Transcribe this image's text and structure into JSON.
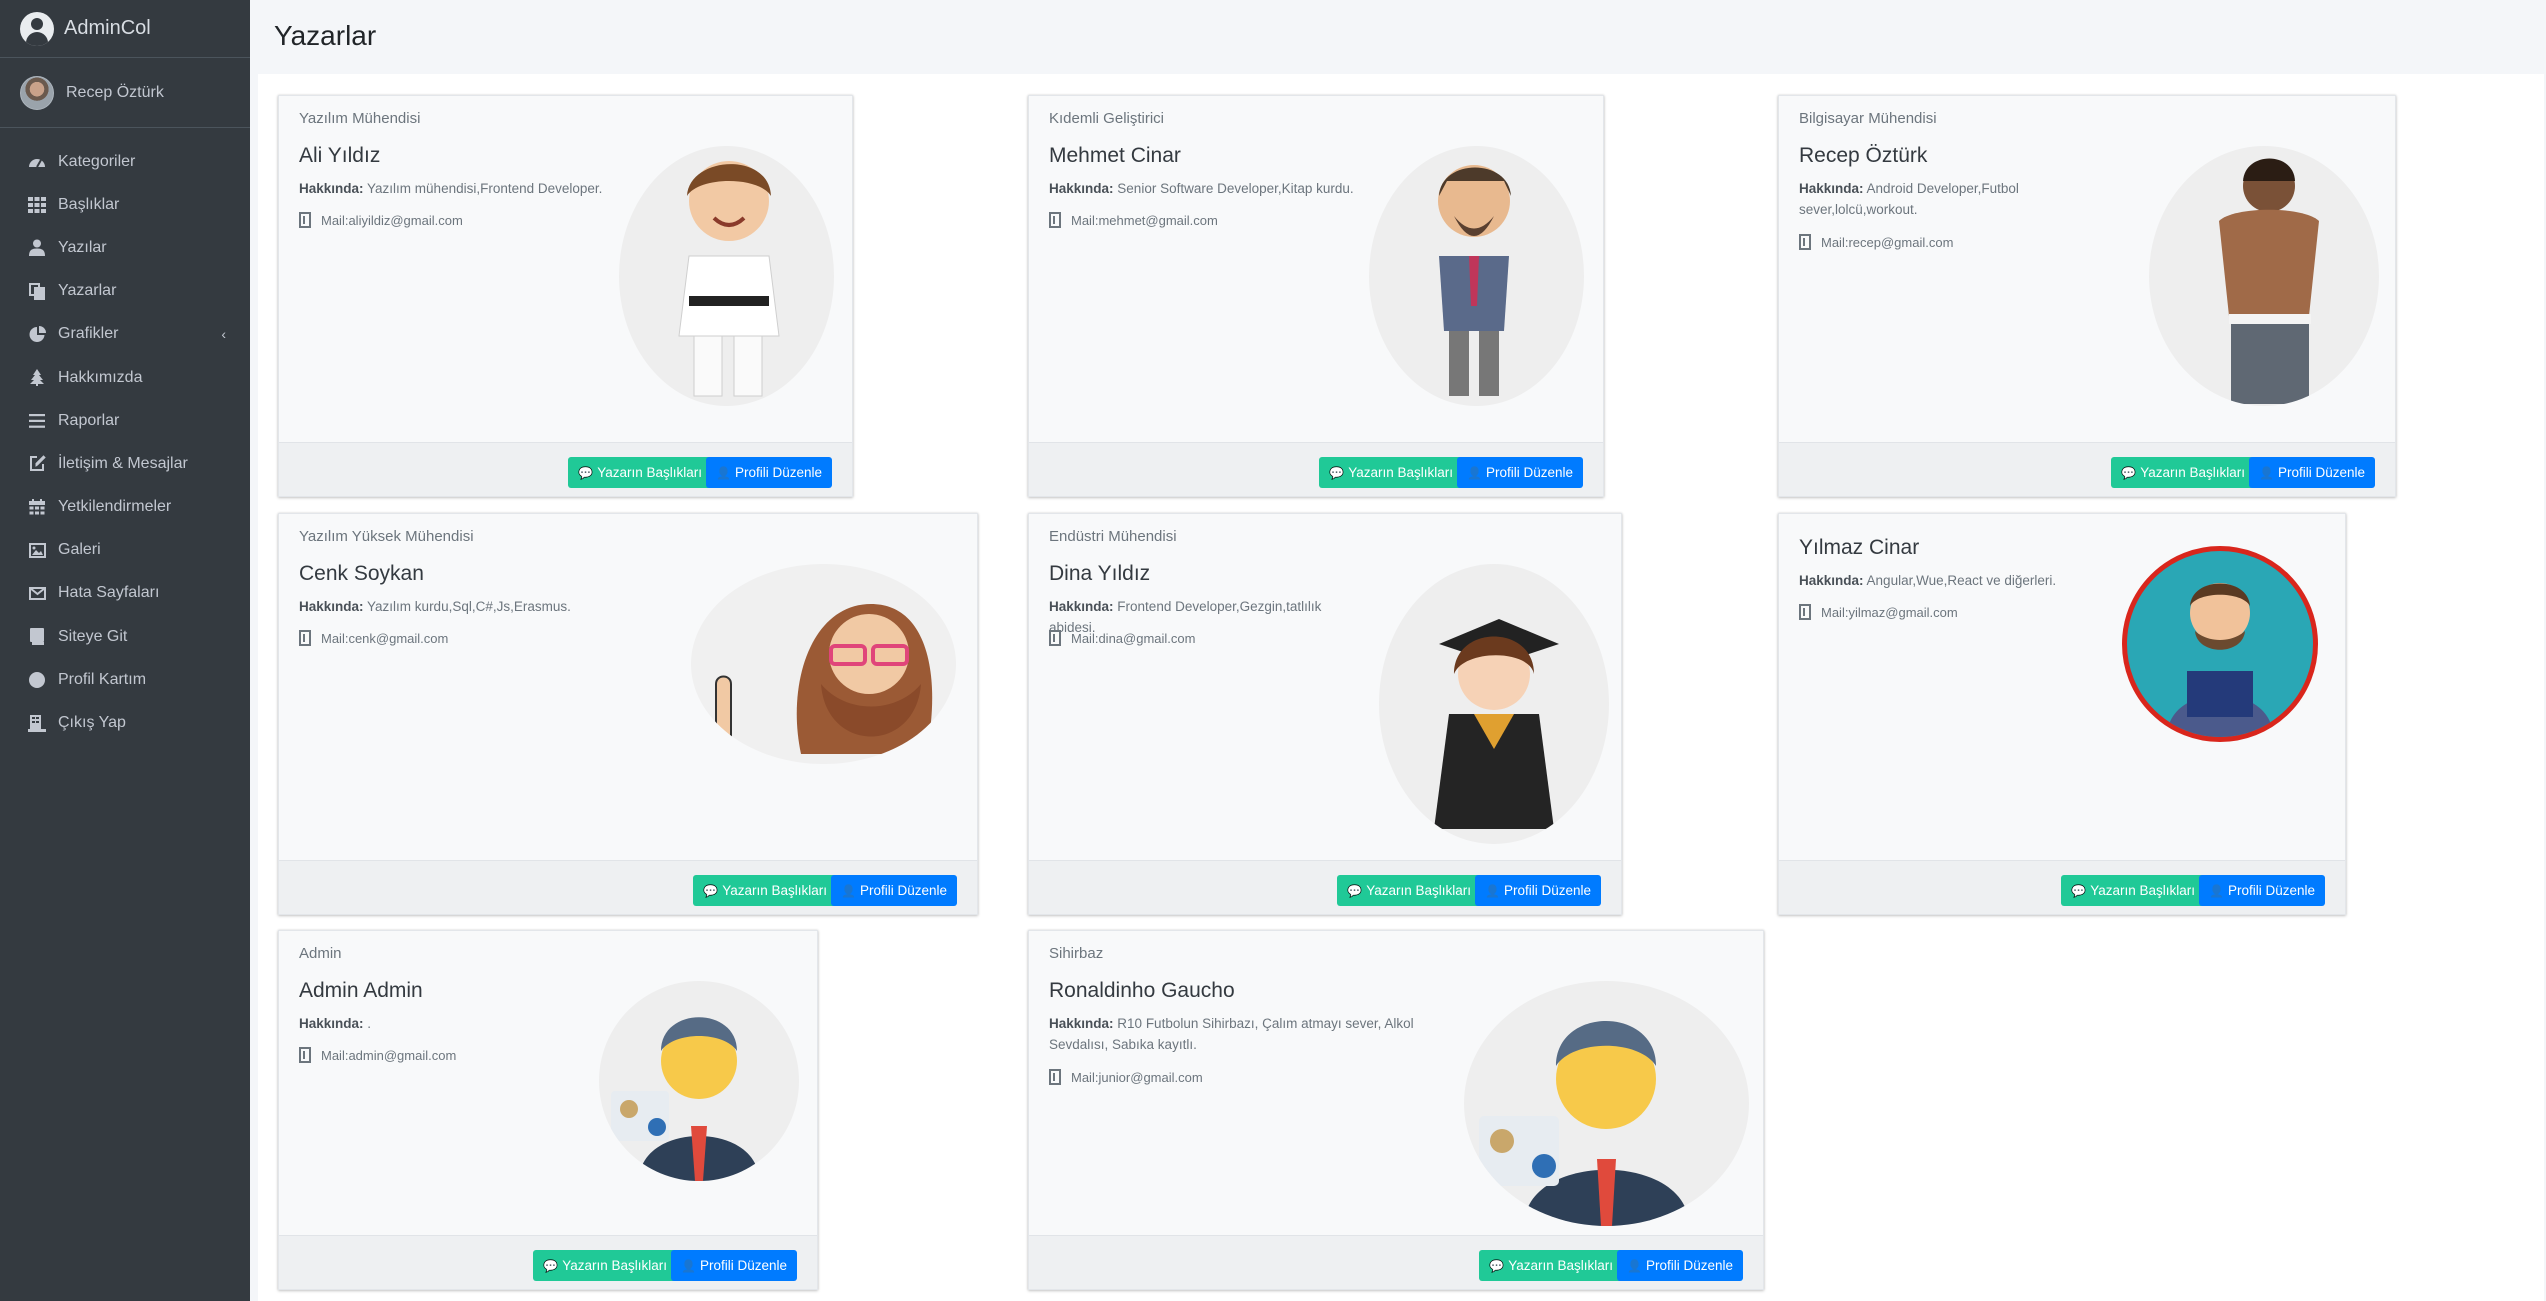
{
  "brand": {
    "name": "AdminCol"
  },
  "user": {
    "name": "Recep Öztürk"
  },
  "sidebar": {
    "items": [
      {
        "label": "Kategoriler",
        "icon": "dashboard-icon"
      },
      {
        "label": "Başlıklar",
        "icon": "grid-icon"
      },
      {
        "label": "Yazılar",
        "icon": "user-tie-icon"
      },
      {
        "label": "Yazarlar",
        "icon": "copy-icon"
      },
      {
        "label": "Grafikler",
        "icon": "chart-pie-icon"
      },
      {
        "label": "Hakkımızda",
        "icon": "tree-icon"
      },
      {
        "label": "Raporlar",
        "icon": "list-icon"
      },
      {
        "label": "İletişim & Mesajlar",
        "icon": "edit-icon"
      },
      {
        "label": "Yetkilendirmeler",
        "icon": "calendar-icon"
      },
      {
        "label": "Galeri",
        "icon": "image-icon"
      },
      {
        "label": "Hata Sayfaları",
        "icon": "envelope-icon"
      },
      {
        "label": "Siteye Git",
        "icon": "book-icon"
      },
      {
        "label": "Profil Kartım",
        "icon": "circle-icon"
      },
      {
        "label": "Çıkış Yap",
        "icon": "user-exit-icon"
      }
    ]
  },
  "page": {
    "title": "Yazarlar"
  },
  "about_label": "Hakkında:",
  "buttons": {
    "titles": "Yazarın Başlıkları",
    "edit": "Profili Düzenle"
  },
  "writers": [
    {
      "role": "Yazılım Mühendisi",
      "name": "Ali Yıldız",
      "about": "Yazılım mühendisi,Frontend Developer.",
      "mail": "Mail:aliyildiz@gmail.com"
    },
    {
      "role": "Kıdemli Geliştirici",
      "name": "Mehmet Cinar",
      "about": "Senior Software Developer,Kitap kurdu.",
      "mail": "Mail:mehmet@gmail.com"
    },
    {
      "role": "Bilgisayar Mühendisi",
      "name": "Recep Öztürk",
      "about": "Android Developer,Futbol sever,lolcü,workout.",
      "mail": "Mail:recep@gmail.com"
    },
    {
      "role": "Yazılım Yüksek Mühendisi",
      "name": "Cenk Soykan",
      "about": "Yazılım kurdu,Sql,C#,Js,Erasmus.",
      "mail": "Mail:cenk@gmail.com"
    },
    {
      "role": "Endüstri Mühendisi",
      "name": "Dina Yıldız",
      "about": "Frontend Developer,Gezgin,tatlılık abidesi.",
      "mail": "Mail:dina@gmail.com"
    },
    {
      "role": "",
      "name": "Yılmaz Cinar",
      "about": "Angular,Wue,React ve diğerleri.",
      "mail": "Mail:yilmaz@gmail.com"
    },
    {
      "role": "Admin",
      "name": "Admin Admin",
      "about": ".",
      "mail": "Mail:admin@gmail.com"
    },
    {
      "role": "Sihirbaz",
      "name": "Ronaldinho Gaucho",
      "about": "R10 Futbolun Sihirbazı, Çalım atmayı sever, Alkol Sevdalısı, Sabıka kayıtlı.",
      "mail": "Mail:junior@gmail.com"
    }
  ],
  "colors": {
    "sidebar": "#343a40",
    "success": "#20c997",
    "primary": "#007bff"
  }
}
